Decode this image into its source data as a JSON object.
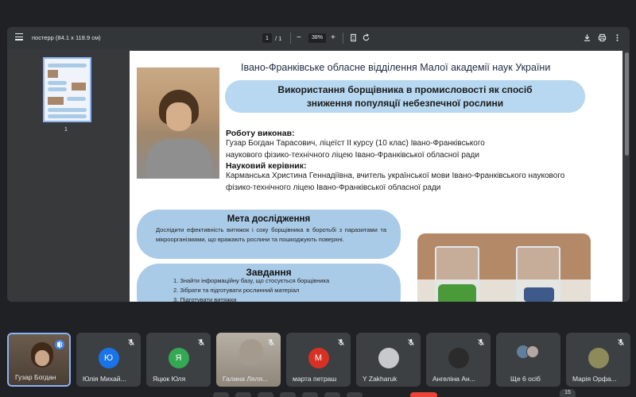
{
  "pdf": {
    "title": "постерр (84.1 x 118.9 см)",
    "page_current": "1",
    "page_total": "/  1",
    "zoom_minus": "−",
    "zoom": "38%",
    "zoom_plus": "+",
    "thumbnail_page": "1"
  },
  "poster": {
    "org": "Івано-Франківське обласне відділення Малої академії наук України",
    "title_line1": "Використання борщівника в промисловості як  спосіб",
    "title_line2": "зниження популяції небезпечної рослини",
    "author_label": "Роботу виконав:",
    "author_line1": "Гузар Богдан Тарасович, ліцеїст ІІ курсу (10 клас) Івано-Франківського",
    "author_line2": "наукового фізико-технічного ліцею Івано-Франківської обласної ради",
    "supervisor_label": "Науковий керівник:",
    "supervisor_line1": "Карманська Христина Геннадіївна, вчитель української мови Івано-Франківського наукового",
    "supervisor_line2": "фізико-технічного ліцею Івано-Франківської обласної ради",
    "goal_title": "Мета дослідження",
    "goal_text": "Дослідити ефективність витяжок і соку борщівника в боротьбі з паразитами та мікроорганізмами, що вражають рослини та пошкоджують поверхні.",
    "tasks_title": "Завдання",
    "tasks": [
      "1. Знайти інформаційну базу, що стосується борщівника",
      "2. Зібрати та підготувати рослинний матеріал",
      "3. Підготувати витяжки"
    ]
  },
  "participants": [
    {
      "name": "Гузар Богдан",
      "type": "camera",
      "speaking": true
    },
    {
      "name": "Юлія Михай...",
      "initial": "Ю",
      "color": "#1a73e8",
      "muted": true
    },
    {
      "name": "Яцюк Юля",
      "initial": "Я",
      "color": "#34a853",
      "muted": true
    },
    {
      "name": "Галина Ляля...",
      "type": "camera2",
      "muted": true
    },
    {
      "name": "марта петраш",
      "initial": "М",
      "color": "#d93025",
      "muted": true
    },
    {
      "name": "Y Zakharuk",
      "type": "photo",
      "color": "#9aa0a6",
      "muted": true
    },
    {
      "name": "Ангеліна Ан...",
      "type": "photo",
      "color": "#2b2b2b",
      "muted": true
    },
    {
      "name": "Ще 6 осіб",
      "type": "more"
    },
    {
      "name": "Марія Орфа...",
      "type": "photo",
      "color": "#8f8a5a",
      "muted": true
    }
  ],
  "participant_count": "15",
  "colors": {
    "accent": "#8ab4f8",
    "pill": "#aacbe8",
    "title_pill": "#b7d8f0",
    "end_call": "#ea4335"
  },
  "icons": [
    "menu-icon",
    "download-icon",
    "print-icon",
    "more-icon",
    "fit-page-icon",
    "rotate-icon",
    "mic-off-icon",
    "speaking-icon"
  ]
}
